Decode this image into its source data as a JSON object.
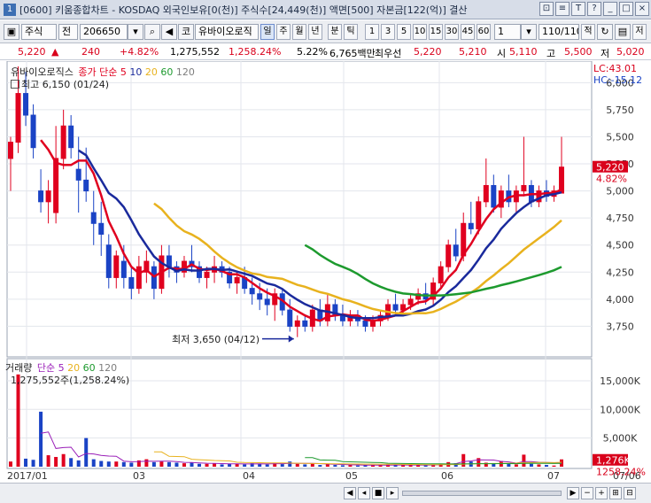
{
  "window": {
    "num": "1",
    "title": "[0600] 키움종합차트 - KOSDAQ 외국인보유[0(천)] 주식수[24,449(천)] 액면[500] 자본금[122(억)] 결산",
    "btns": [
      "⊡",
      "≡",
      "T",
      "?"
    ]
  },
  "toolbar": {
    "market": "주식",
    "prev": "전",
    "code": "206650",
    "search_icon": "⌕",
    "sound_icon": "◀",
    "kosdaq": "코",
    "name": "유바이오로직",
    "periods": [
      "일",
      "주",
      "월",
      "년",
      "분",
      "틱"
    ],
    "nums": [
      "1",
      "3",
      "5",
      "10",
      "15",
      "30",
      "45",
      "60"
    ],
    "interval": "1",
    "page": "110/110",
    "labels": [
      "적",
      "저"
    ]
  },
  "info": {
    "price": "5,220",
    "arrow": "▲",
    "change": "240",
    "pct": "+4.82%",
    "volume": "1,275,552",
    "vol_pct": "1,258.24%",
    "turnover": "5.22%",
    "amount": "6,765백만",
    "best_label": "최우선",
    "ask": "5,220",
    "bid": "5,210",
    "open_label": "시",
    "open": "5,110",
    "high_label": "고",
    "high": "5,500",
    "low_label": "저",
    "low": "5,020"
  },
  "price_panel": {
    "name": "유바이오로직스",
    "ma_label": "종가 단순",
    "ma_periods": [
      "5",
      "10",
      "20",
      "60",
      "120"
    ],
    "ma_colors": [
      "#e0001f",
      "#1a2a9c",
      "#e8b21e",
      "#1d9a2e",
      "#7d7d7d"
    ],
    "high_note": "최고 6,150 (01/24)",
    "low_note": "최저 3,650 (04/12)",
    "lc": "LC:43.01",
    "hc": "HC:-15.12",
    "y_ticks": [
      "6,000",
      "5,750",
      "5,500",
      "5,250",
      "5,000",
      "4,750",
      "4,500",
      "4,250",
      "4,000",
      "3,750"
    ],
    "current": "5,220",
    "current_pct": "4.82%"
  },
  "volume_panel": {
    "label": "거래량",
    "ma_label": "단순",
    "ma_periods": [
      "5",
      "20",
      "60",
      "120"
    ],
    "ma_colors": [
      "#9a1fb8",
      "#e8b21e",
      "#1d9a2e",
      "#7d7d7d"
    ],
    "value_note": "1,275,552주(1,258.24%)",
    "y_ticks": [
      "15,000K",
      "10,000K",
      "5,000K"
    ],
    "current": "1,276K",
    "current_pct": "1258.24%"
  },
  "x_axis": [
    "2017/01",
    "03",
    "04",
    "05",
    "06",
    "07",
    "07/06"
  ],
  "chart_data": {
    "type": "candlestick",
    "title": "유바이오로직스",
    "ylim": [
      3500,
      6150
    ],
    "ohlc": [
      [
        5300,
        5500,
        5000,
        5450
      ],
      [
        5450,
        6150,
        5350,
        5900
      ],
      [
        5900,
        6100,
        5600,
        5700
      ],
      [
        5700,
        5800,
        5300,
        5400
      ],
      [
        5000,
        5200,
        4800,
        4900
      ],
      [
        4900,
        5100,
        4700,
        5000
      ],
      [
        4800,
        5600,
        4700,
        5300
      ],
      [
        5300,
        5750,
        5200,
        5600
      ],
      [
        5600,
        5700,
        5300,
        5400
      ],
      [
        5200,
        5500,
        4800,
        5100
      ],
      [
        5100,
        5400,
        4900,
        5000
      ],
      [
        4800,
        5000,
        4500,
        4700
      ],
      [
        4700,
        4900,
        4400,
        4600
      ],
      [
        4500,
        4600,
        4100,
        4200
      ],
      [
        4200,
        4450,
        4100,
        4400
      ],
      [
        4350,
        4500,
        4100,
        4200
      ],
      [
        4200,
        4300,
        4000,
        4100
      ],
      [
        4100,
        4400,
        4050,
        4300
      ],
      [
        4250,
        4450,
        4150,
        4350
      ],
      [
        4300,
        4350,
        4000,
        4100
      ],
      [
        4100,
        4500,
        4050,
        4400
      ],
      [
        4400,
        4500,
        4200,
        4300
      ],
      [
        4300,
        4350,
        4150,
        4250
      ],
      [
        4250,
        4400,
        4200,
        4350
      ],
      [
        4350,
        4500,
        4250,
        4300
      ],
      [
        4300,
        4350,
        4150,
        4200
      ],
      [
        4200,
        4300,
        4100,
        4250
      ],
      [
        4250,
        4400,
        4150,
        4300
      ],
      [
        4300,
        4350,
        4200,
        4250
      ],
      [
        4250,
        4300,
        4100,
        4150
      ],
      [
        4150,
        4250,
        4050,
        4200
      ],
      [
        4200,
        4300,
        4050,
        4100
      ],
      [
        4100,
        4200,
        3950,
        4050
      ],
      [
        4050,
        4150,
        3900,
        4000
      ],
      [
        4000,
        4100,
        3850,
        3950
      ],
      [
        3950,
        4100,
        3800,
        4050
      ],
      [
        4050,
        4100,
        3850,
        3900
      ],
      [
        3900,
        4000,
        3700,
        3750
      ],
      [
        3750,
        3850,
        3650,
        3800
      ],
      [
        3800,
        3850,
        3700,
        3750
      ],
      [
        3750,
        3950,
        3700,
        3900
      ],
      [
        3900,
        4000,
        3750,
        3800
      ],
      [
        3800,
        4050,
        3750,
        3950
      ],
      [
        3950,
        4000,
        3800,
        3850
      ],
      [
        3850,
        3950,
        3750,
        3800
      ],
      [
        3800,
        3900,
        3750,
        3850
      ],
      [
        3850,
        3900,
        3750,
        3800
      ],
      [
        3800,
        3850,
        3700,
        3750
      ],
      [
        3750,
        3850,
        3700,
        3800
      ],
      [
        3800,
        3900,
        3750,
        3850
      ],
      [
        3850,
        4000,
        3800,
        3950
      ],
      [
        3950,
        4050,
        3850,
        3900
      ],
      [
        3900,
        4000,
        3850,
        3950
      ],
      [
        3950,
        4050,
        3900,
        4000
      ],
      [
        4000,
        4100,
        3950,
        4050
      ],
      [
        4050,
        4150,
        3950,
        4000
      ],
      [
        4000,
        4200,
        3950,
        4150
      ],
      [
        4150,
        4350,
        4100,
        4300
      ],
      [
        4300,
        4550,
        4250,
        4500
      ],
      [
        4500,
        4650,
        4350,
        4400
      ],
      [
        4400,
        4800,
        4350,
        4700
      ],
      [
        4700,
        4900,
        4600,
        4650
      ],
      [
        4650,
        4950,
        4600,
        4900
      ],
      [
        4900,
        5300,
        4850,
        5050
      ],
      [
        5050,
        5150,
        4800,
        4850
      ],
      [
        4850,
        5050,
        4750,
        5000
      ],
      [
        5000,
        5150,
        4850,
        4900
      ],
      [
        4900,
        5050,
        4800,
        5000
      ],
      [
        5000,
        5500,
        4950,
        5050
      ],
      [
        5050,
        5100,
        4850,
        4900
      ],
      [
        4900,
        5050,
        4850,
        5000
      ],
      [
        5000,
        5100,
        4900,
        4950
      ],
      [
        4950,
        5050,
        4900,
        5000
      ],
      [
        4980,
        5500,
        5020,
        5220
      ]
    ],
    "volume_k": [
      900,
      16100,
      1400,
      1200,
      9600,
      2000,
      1700,
      2200,
      1500,
      1100,
      5000,
      1300,
      1000,
      900,
      900,
      800,
      700,
      1100,
      1300,
      800,
      900,
      800,
      700,
      600,
      700,
      500,
      500,
      600,
      400,
      500,
      500,
      400,
      600,
      500,
      400,
      700,
      450,
      900,
      500,
      400,
      600,
      300,
      500,
      300,
      250,
      300,
      200,
      250,
      300,
      250,
      350,
      300,
      250,
      300,
      250,
      300,
      400,
      500,
      800,
      600,
      2200,
      900,
      1500,
      700,
      500,
      1000,
      500,
      400,
      2100,
      500,
      400,
      300,
      200,
      1276
    ]
  }
}
